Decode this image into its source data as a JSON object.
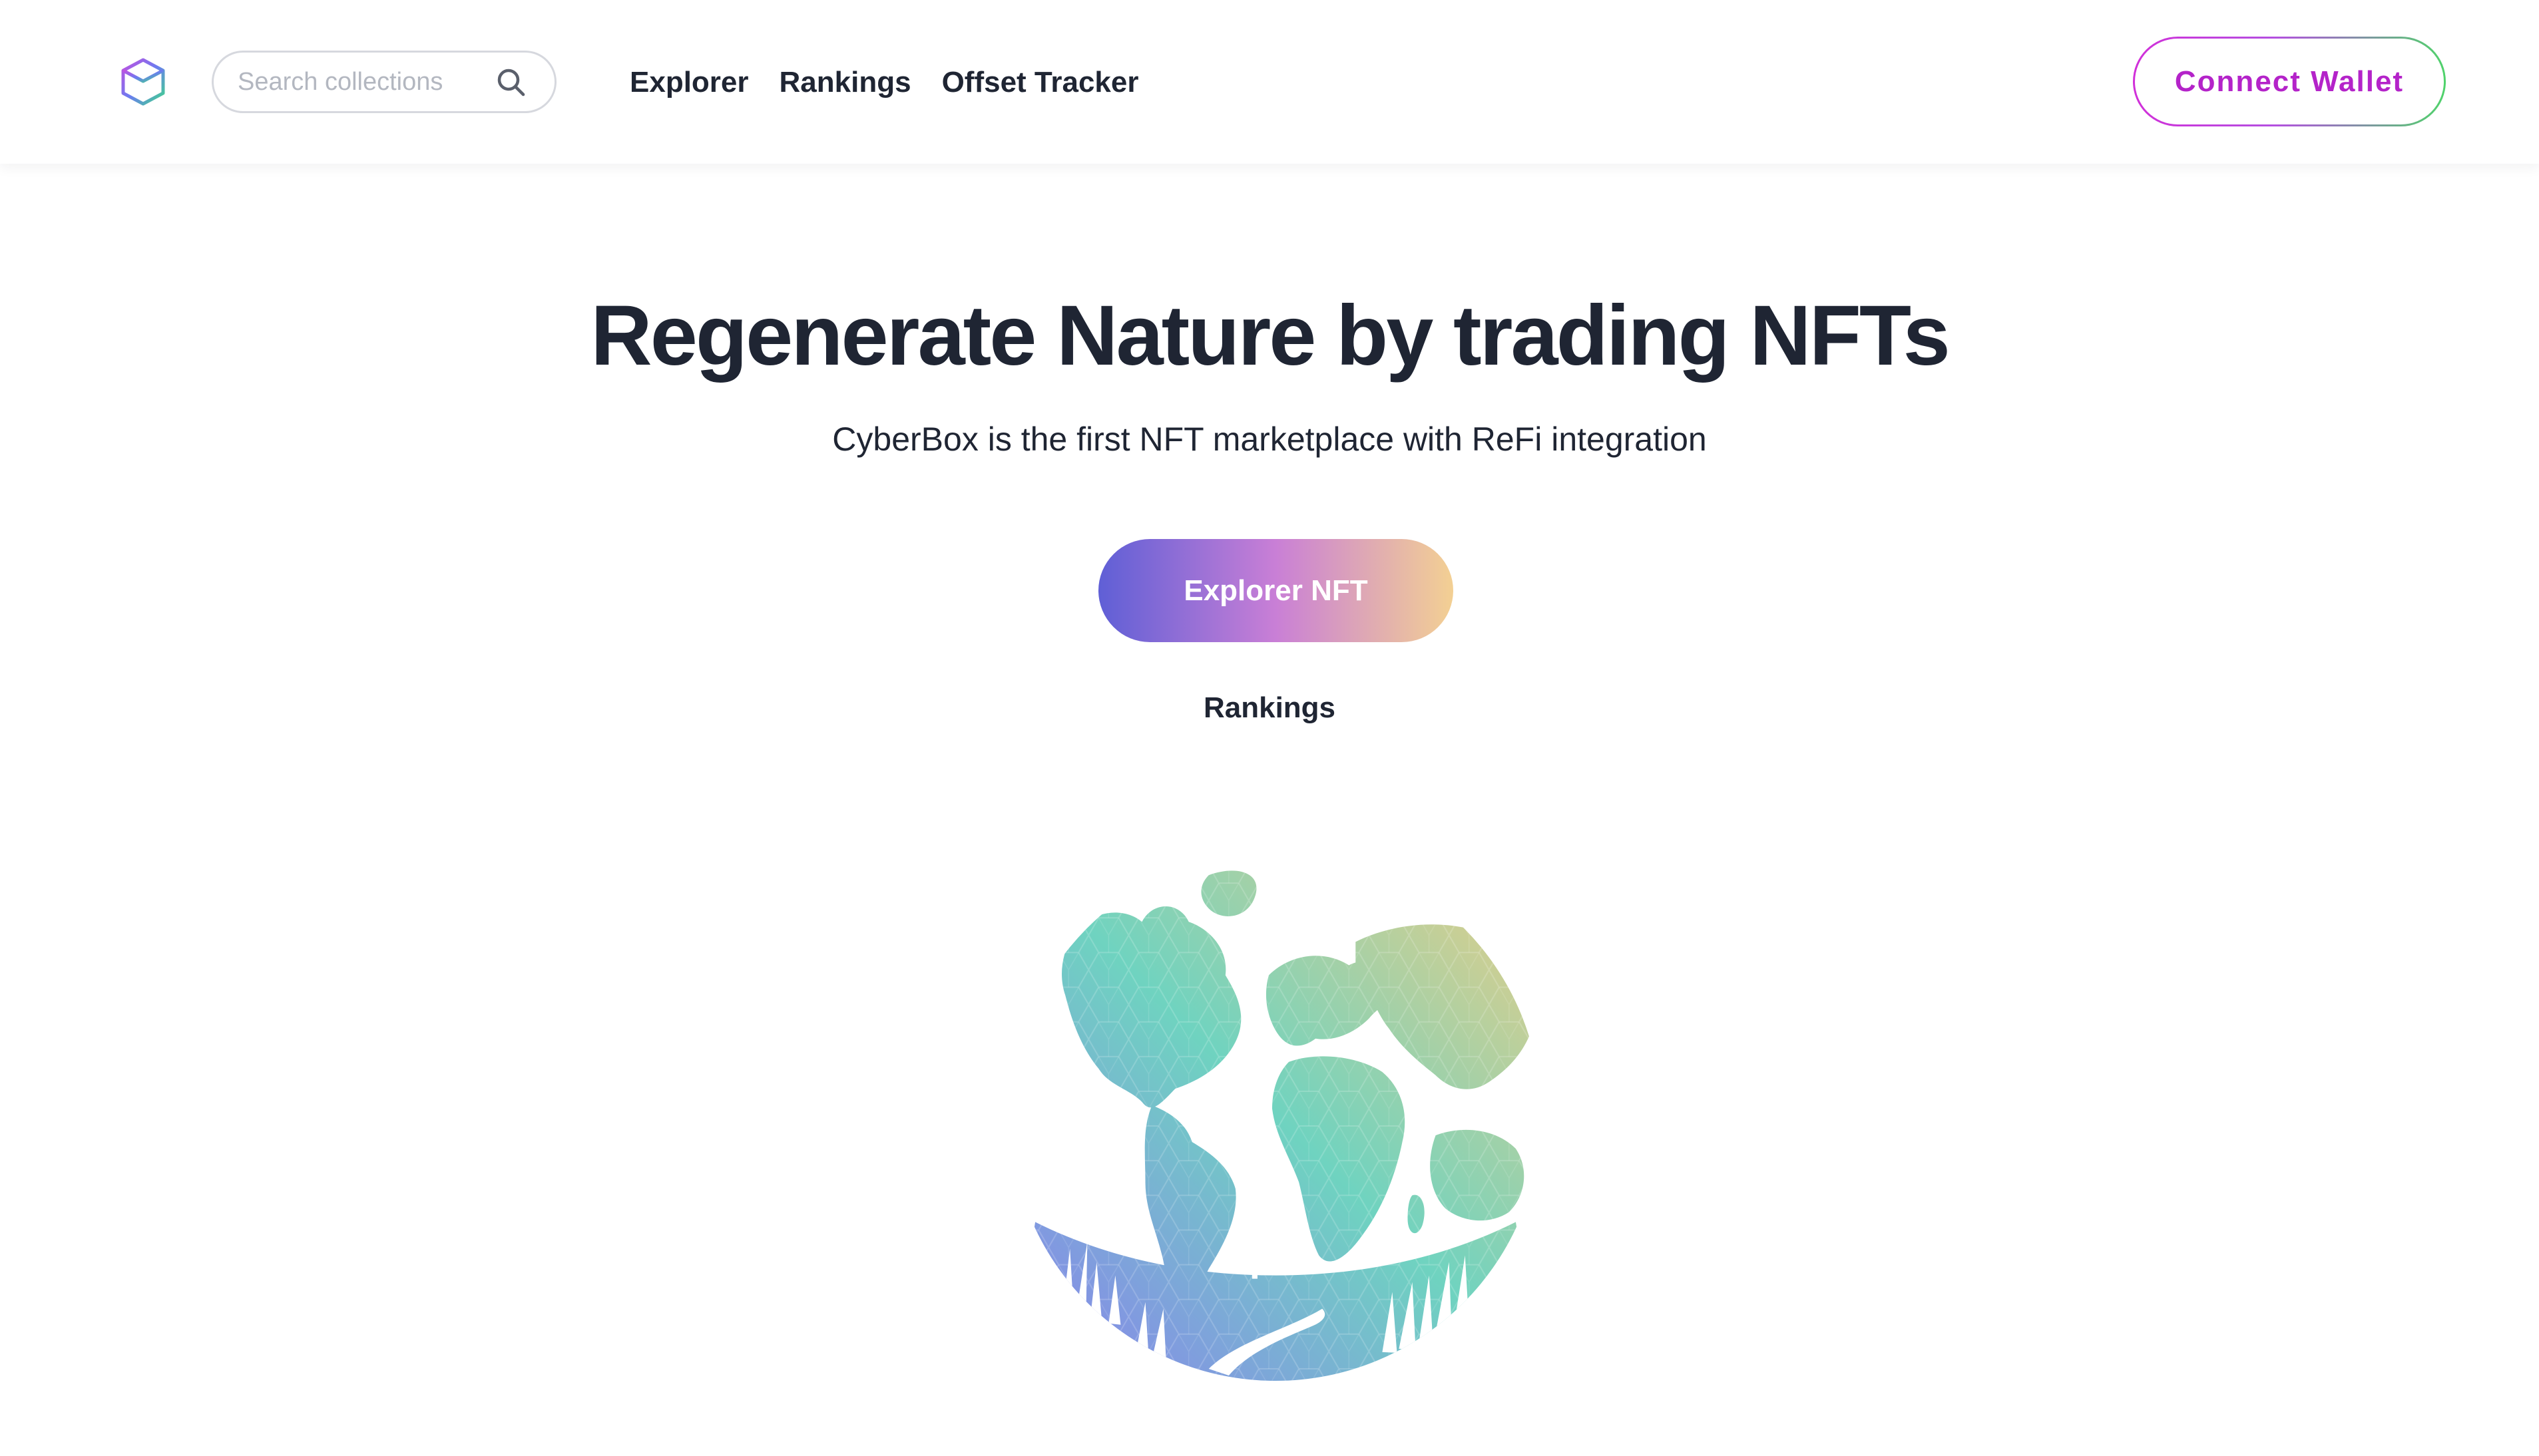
{
  "header": {
    "search": {
      "placeholder": "Search collections",
      "value": ""
    },
    "nav": [
      {
        "label": "Explorer"
      },
      {
        "label": "Rankings"
      },
      {
        "label": "Offset Tracker"
      }
    ],
    "connect_wallet_label": "Connect Wallet"
  },
  "hero": {
    "title": "Regenerate Nature by trading NFTs",
    "subtitle": "CyberBox is the first NFT marketplace with ReFi integration",
    "cta_label": "Explorer NFT",
    "secondary_link_label": "Rankings"
  },
  "icons": {
    "logo": "cube-logo-icon",
    "search": "search-icon",
    "hero_art": "earth-globe-icon"
  },
  "colors": {
    "text_primary": "#1f2533",
    "connect_gradient": [
      "#d12fd9",
      "#4fd36a"
    ],
    "connect_text": "#b423c9",
    "cta_gradient": [
      "#5f5fd6",
      "#c97fd6",
      "#f3d093"
    ],
    "globe_gradient": [
      "#8a7cf0",
      "#6fd3c0",
      "#f0cd83"
    ]
  }
}
